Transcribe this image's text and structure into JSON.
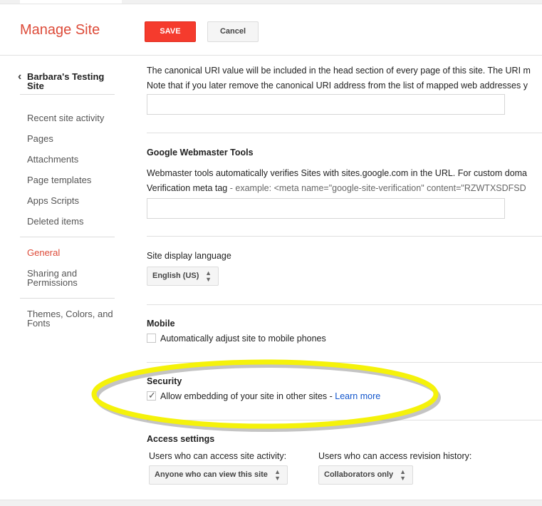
{
  "header": {
    "title": "Manage Site",
    "save_label": "SAVE",
    "cancel_label": "Cancel"
  },
  "sidebar": {
    "site_name": "Barbara's Testing Site",
    "back_icon": "chevron-left-icon",
    "groups": [
      {
        "items": [
          {
            "label": "Recent site activity"
          },
          {
            "label": "Pages"
          },
          {
            "label": "Attachments"
          },
          {
            "label": "Page templates"
          },
          {
            "label": "Apps Scripts"
          },
          {
            "label": "Deleted items"
          }
        ]
      },
      {
        "items": [
          {
            "label": "General",
            "active": true
          },
          {
            "label": "Sharing and Permissions"
          }
        ]
      },
      {
        "items": [
          {
            "label": "Themes, Colors, and Fonts"
          }
        ]
      }
    ]
  },
  "main": {
    "canonical": {
      "line1": "The canonical URI value will be included in the head section of every page of this site. The URI m",
      "line2": "Note that if you later remove the canonical URI address from the list of mapped web addresses y",
      "value": ""
    },
    "webmaster": {
      "heading": "Google Webmaster Tools",
      "line1": "Webmaster tools automatically verifies Sites with sites.google.com in the URL. For custom doma",
      "label": "Verification meta tag",
      "example": " - example: <meta name=\"google-site-verification\" content=\"RZWTXSDFSD",
      "value": ""
    },
    "language": {
      "label": "Site display language",
      "selected": "English (US)"
    },
    "mobile": {
      "heading": "Mobile",
      "checkbox_label": "Automatically adjust site to mobile phones",
      "checked": false
    },
    "security": {
      "heading": "Security",
      "checkbox_label": "Allow embedding of your site in other sites - ",
      "link": "Learn more",
      "checked": true,
      "highlight_color": "#f5f20a"
    },
    "access": {
      "heading": "Access settings",
      "activity_label": "Users who can access site activity:",
      "activity_selected": "Anyone who can view this site",
      "revision_label": "Users who can access revision history:",
      "revision_selected": "Collaborators only"
    }
  },
  "colors": {
    "accent": "#dd4b39",
    "save_button": "#f53b2d",
    "link": "#1155cc"
  }
}
